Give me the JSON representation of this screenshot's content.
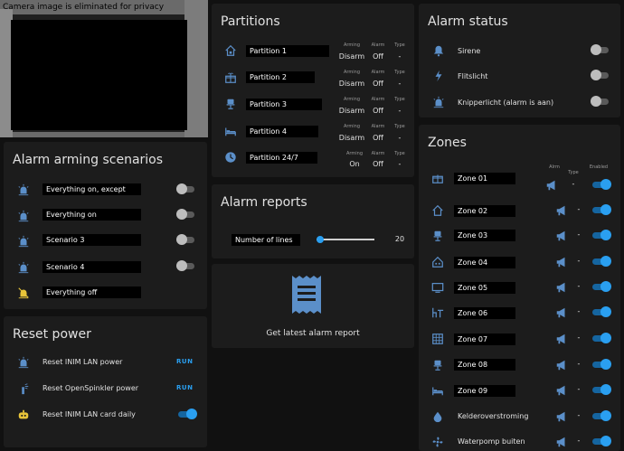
{
  "camera": {
    "caption": "Camera image is eliminated for privacy"
  },
  "scenarios": {
    "title": "Alarm arming scenarios",
    "items": [
      {
        "label": "Everything on, except",
        "on": false
      },
      {
        "label": "Everything on",
        "on": false
      },
      {
        "label": "Scenario 3",
        "on": false
      },
      {
        "label": "Scenario 4",
        "on": false
      },
      {
        "label": "Everything off"
      }
    ]
  },
  "reset": {
    "title": "Reset power",
    "items": [
      {
        "label": "Reset INIM LAN power",
        "action": "RUN"
      },
      {
        "label": "Reset OpenSpinkler power",
        "action": "RUN"
      },
      {
        "label": "Reset INIM LAN card daily",
        "on": true
      }
    ]
  },
  "partitions": {
    "title": "Partitions",
    "head": {
      "arming": "Arming",
      "alarm": "Alarm",
      "type": "Type"
    },
    "items": [
      {
        "label": "Partition 1",
        "arming": "Disarm",
        "alarm": "Off",
        "type": "-"
      },
      {
        "label": "Partition 2",
        "arming": "Disarm",
        "alarm": "Off",
        "type": "-"
      },
      {
        "label": "Partition 3",
        "arming": "Disarm",
        "alarm": "Off",
        "type": "-"
      },
      {
        "label": "Partition 4",
        "arming": "Disarm",
        "alarm": "Off",
        "type": "-"
      },
      {
        "label": "Partition 24/7",
        "arming": "On",
        "alarm": "Off",
        "type": "-"
      }
    ]
  },
  "reports": {
    "title": "Alarm reports",
    "slider_label": "Number of lines",
    "slider_value": "20",
    "slider_fraction": 0.0
  },
  "latest_report": {
    "label": "Get latest alarm report"
  },
  "alarm_status": {
    "title": "Alarm status",
    "items": [
      {
        "label": "Sirene",
        "on": false
      },
      {
        "label": "Flitslicht",
        "on": false
      },
      {
        "label": "Knipperlicht (alarm is aan)",
        "on": false
      }
    ]
  },
  "zones": {
    "title": "Zones",
    "head": {
      "alrm": "Alrm",
      "type": "Type",
      "enabled": "Enabled"
    },
    "items": [
      {
        "label": "Zone 01",
        "type": "-",
        "enabled": true
      },
      {
        "label": "Zone 02",
        "type": "-",
        "enabled": true
      },
      {
        "label": "Zone 03",
        "type": "-",
        "enabled": true
      },
      {
        "label": "Zone 04",
        "type": "-",
        "enabled": true
      },
      {
        "label": "Zone 05",
        "type": "-",
        "enabled": true
      },
      {
        "label": "Zone 06",
        "type": "-",
        "enabled": true
      },
      {
        "label": "Zone 07",
        "type": "-",
        "enabled": true
      },
      {
        "label": "Zone 08",
        "type": "-",
        "enabled": true
      },
      {
        "label": "Zone 09",
        "type": "-",
        "enabled": true
      },
      {
        "label": "Kelderoverstroming",
        "type": "-",
        "enabled": true
      },
      {
        "label": "Waterpomp buiten",
        "type": "-",
        "enabled": true
      }
    ]
  },
  "colors": {
    "accent": "#2a9ff0",
    "card": "#1c1c1c",
    "background": "#111111",
    "icon": "#5b8fc9",
    "warning": "#e8c43a"
  }
}
